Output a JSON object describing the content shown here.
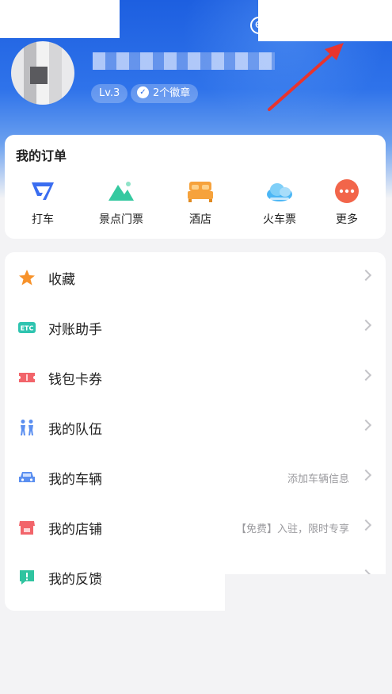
{
  "header": {
    "username": "",
    "level": "Lv.3",
    "medals": "2个徽章",
    "accent": "#2f73ea"
  },
  "orders": {
    "title": "我的订单",
    "items": [
      {
        "label": "打车",
        "icon": "taxi-icon",
        "color": "#3a6df0"
      },
      {
        "label": "景点门票",
        "icon": "mountain-icon",
        "color": "#35c9a0"
      },
      {
        "label": "酒店",
        "icon": "bed-icon",
        "color": "#f6a23c"
      },
      {
        "label": "火车票",
        "icon": "train-cloud-icon",
        "color": "#4bb6f5"
      },
      {
        "label": "更多",
        "icon": "more-icon",
        "color": "#f2654a"
      }
    ]
  },
  "menu": {
    "items": [
      {
        "label": "收藏",
        "hint": "",
        "icon": "star-icon"
      },
      {
        "label": "对账助手",
        "hint": "",
        "icon": "etc-icon"
      },
      {
        "label": "钱包卡券",
        "hint": "",
        "icon": "ticket-icon"
      },
      {
        "label": "我的队伍",
        "hint": "",
        "icon": "team-icon"
      },
      {
        "label": "我的车辆",
        "hint": "添加车辆信息",
        "icon": "car-icon"
      },
      {
        "label": "我的店铺",
        "hint": "【免费】入驻，限时专享",
        "icon": "shop-icon"
      },
      {
        "label": "我的反馈",
        "hint": "",
        "icon": "feedback-icon"
      }
    ]
  }
}
